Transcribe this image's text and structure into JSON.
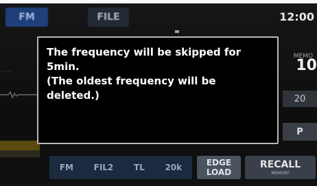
{
  "top_bar": {
    "tabs": [
      {
        "label": "FM"
      },
      {
        "label": "FILE"
      }
    ],
    "clock": "12:00"
  },
  "right_panel": {
    "top_label": "MEMO",
    "big_value": "10",
    "box1": "20",
    "box2": "P"
  },
  "bottom_bar": {
    "group_items": [
      "FM",
      "FIL2",
      "TL",
      "20k"
    ],
    "edge_line1": "EDGE",
    "edge_line2": "LOAD",
    "recall_label": "RECALL",
    "recall_sub": "MEMORY"
  },
  "dialog": {
    "lines": [
      "The frequency will be skipped for",
      "5min.",
      "(The oldest frequency will be",
      "deleted.)"
    ]
  },
  "colors": {
    "screen_bg": "#121212",
    "dialog_bg": "#000000",
    "dialog_border": "#b9b9b9",
    "fm_tab": "#1e3f7a"
  }
}
